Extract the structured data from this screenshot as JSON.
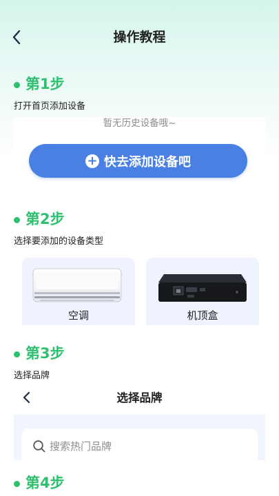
{
  "header": {
    "title": "操作教程",
    "back_icon": "chevron-left-icon"
  },
  "colors": {
    "accent_green": "#2fbf6f",
    "primary_blue": "#4a80e3",
    "card_bg": "#eef3fd"
  },
  "steps": [
    {
      "title": "第1步",
      "desc": "打开首页添加设备",
      "empty_text": "暂无历史设备哦~",
      "button_label": "快去添加设备吧",
      "button_icon": "plus-circle-icon"
    },
    {
      "title": "第2步",
      "desc": "选择要添加的设备类型",
      "devices": [
        {
          "label": "空调",
          "icon": "air-conditioner-image"
        },
        {
          "label": "机顶盒",
          "icon": "set-top-box-image"
        }
      ]
    },
    {
      "title": "第3步",
      "desc": "选择品牌",
      "panel_title": "选择品牌",
      "search_placeholder": "搜索热门品牌",
      "search_icon": "search-icon"
    },
    {
      "title": "第4步"
    }
  ]
}
